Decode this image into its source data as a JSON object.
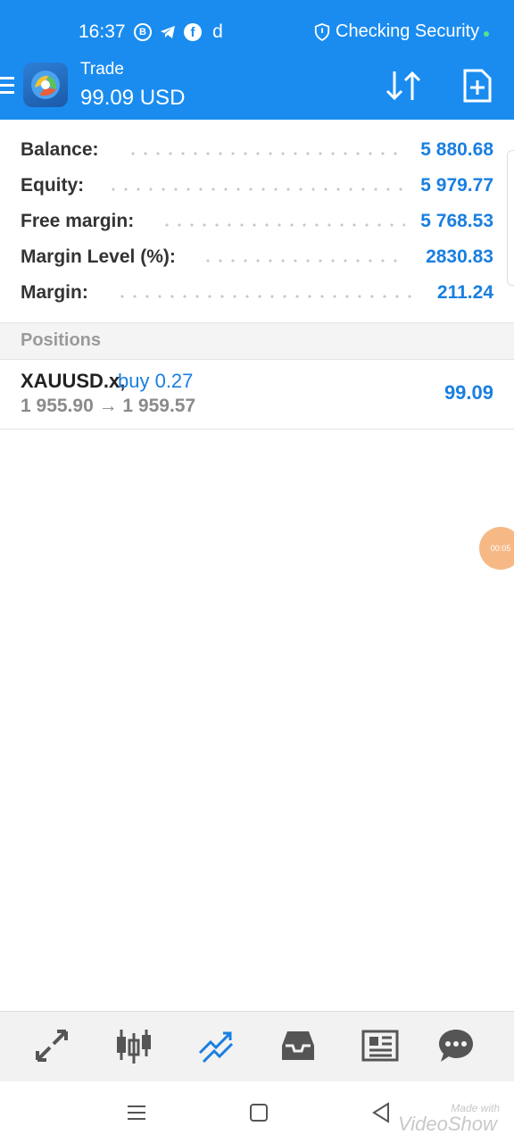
{
  "status_bar": {
    "time": "16:37",
    "app_icons": [
      "B",
      "telegram-icon",
      "f",
      "d"
    ],
    "security_text": "Checking Security"
  },
  "app_bar": {
    "title": "Trade",
    "balance": "99.09 USD"
  },
  "summary": [
    {
      "label": "Balance:",
      "value": "5 880.68"
    },
    {
      "label": "Equity:",
      "value": "5 979.77"
    },
    {
      "label": "Free margin:",
      "value": "5 768.53"
    },
    {
      "label": "Margin Level (%):",
      "value": "2830.83"
    },
    {
      "label": "Margin:",
      "value": "211.24"
    }
  ],
  "positions": {
    "title": "Positions",
    "items": [
      {
        "symbol": "XAUUSD.x,",
        "side": "buy 0.27",
        "prices": "1 955.90 → 1 959.57",
        "profit": "99.09"
      }
    ]
  },
  "bubble_text": "00:05",
  "tabs": [
    "quotes-icon",
    "chart-icon",
    "trade-icon",
    "history-icon",
    "news-icon",
    "chat-icon"
  ],
  "watermark": {
    "small": "Made with",
    "big": "VideoShow"
  },
  "colors": {
    "primary": "#1a8cf0",
    "value_blue": "#1a7fe0",
    "positions_header_bg": "#f4f4f4",
    "bubble": "#f6b27a"
  }
}
